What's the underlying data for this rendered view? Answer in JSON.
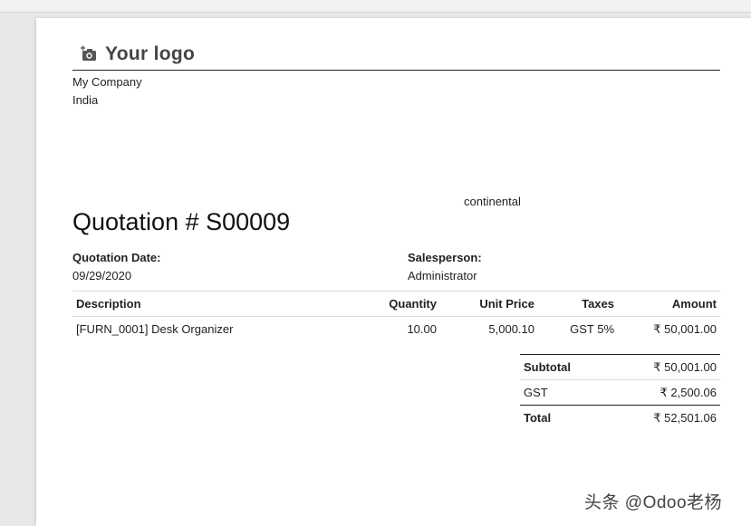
{
  "logo": {
    "text": "Your logo",
    "icon": "camera-plus-icon"
  },
  "company": {
    "name": "My Company",
    "country": "India"
  },
  "partner": {
    "name": "continental"
  },
  "document": {
    "title": "Quotation # S00009"
  },
  "info": {
    "date_label": "Quotation Date:",
    "date_value": "09/29/2020",
    "salesperson_label": "Salesperson:",
    "salesperson_value": "Administrator"
  },
  "table": {
    "headers": [
      "Description",
      "Quantity",
      "Unit Price",
      "Taxes",
      "Amount"
    ],
    "rows": [
      [
        "[FURN_0001] Desk Organizer",
        "10.00",
        "5,000.10",
        "GST 5%",
        "₹ 50,001.00"
      ]
    ]
  },
  "totals": {
    "subtotal_label": "Subtotal",
    "subtotal_value": "₹ 50,001.00",
    "tax_label": "GST",
    "tax_value": "₹ 2,500.06",
    "total_label": "Total",
    "total_value": "₹ 52,501.06"
  },
  "watermark": "头条 @Odoo老杨"
}
